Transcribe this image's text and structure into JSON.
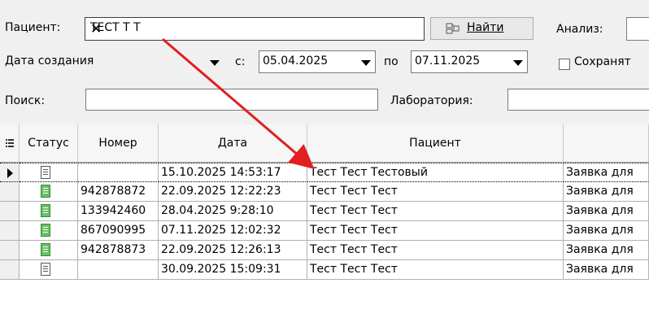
{
  "toolbar": {
    "patient_label": "Пациент:",
    "patient_value": "ТЕСТ Т Т",
    "find_label": "Найти",
    "analysis_label": "Анализ:",
    "date_type_value": "Дата создания",
    "from_label": "с:",
    "from_value": "05.04.2025",
    "to_label": "по",
    "to_value": "07.11.2025",
    "save_label": "Сохранят",
    "search_label": "Поиск:",
    "search_value": "",
    "lab_label": "Лаборатория:"
  },
  "grid": {
    "columns": [
      "Статус",
      "Номер",
      "Дата",
      "Пациент",
      ""
    ],
    "rows": [
      {
        "status": "white",
        "number": "",
        "date": "15.10.2025 14:53:17",
        "patient": "Тест Тест Тестовый",
        "type": "Заявка для",
        "selected": true
      },
      {
        "status": "green",
        "number": "942878872",
        "date": "22.09.2025 12:22:23",
        "patient": "Тест Тест Тест",
        "type": "Заявка для",
        "selected": false
      },
      {
        "status": "green",
        "number": "133942460",
        "date": "28.04.2025 9:28:10",
        "patient": "Тест Тест Тест",
        "type": "Заявка для",
        "selected": false
      },
      {
        "status": "green",
        "number": "867090995",
        "date": "07.11.2025 12:02:32",
        "patient": "Тест Тест Тест",
        "type": "Заявка для",
        "selected": false
      },
      {
        "status": "green",
        "number": "942878873",
        "date": "22.09.2025 12:26:13",
        "patient": "Тест Тест Тест",
        "type": "Заявка для",
        "selected": false
      },
      {
        "status": "white",
        "number": "",
        "date": "30.09.2025 15:09:31",
        "patient": "Тест Тест Тест",
        "type": "Заявка для",
        "selected": false
      }
    ]
  },
  "colors": {
    "arrow": "#e02020",
    "status_green": "#68c068"
  }
}
